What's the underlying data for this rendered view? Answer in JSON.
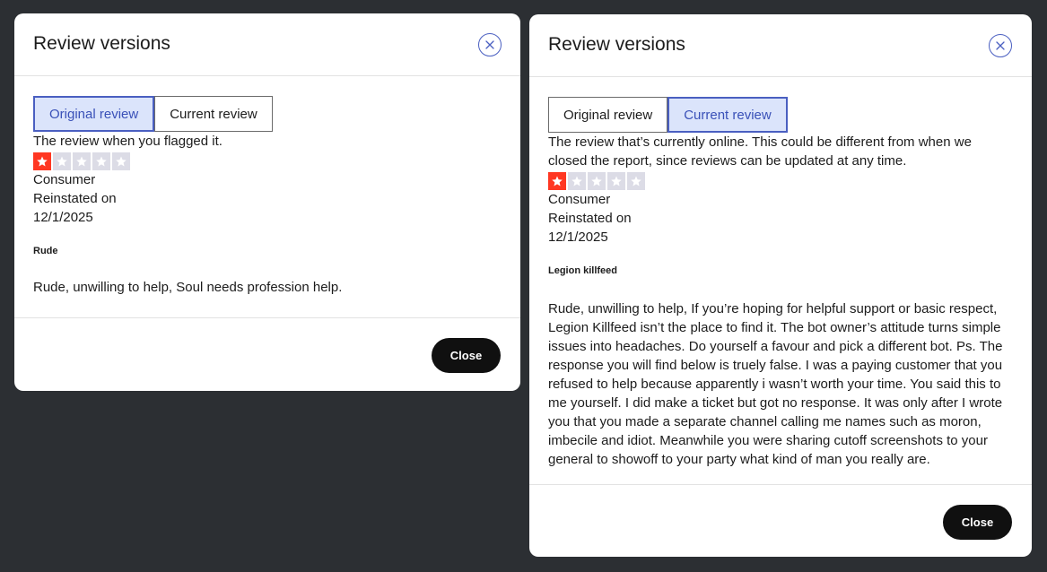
{
  "left_modal": {
    "title": "Review versions",
    "tabs": [
      {
        "label": "Original review",
        "active": true
      },
      {
        "label": "Current review",
        "active": false
      }
    ],
    "description": "The review when you flagged it.",
    "rating": 1,
    "rating_max": 5,
    "author": "Consumer",
    "status_label": "Reinstated on",
    "status_date": "12/1/2025",
    "review_title": "Rude",
    "review_text": "Rude, unwilling to help, Soul needs profession help.",
    "close_label": "Close"
  },
  "right_modal": {
    "title": "Review versions",
    "tabs": [
      {
        "label": "Original review",
        "active": false
      },
      {
        "label": "Current review",
        "active": true
      }
    ],
    "description": "The review that’s currently online. This could be different from when we closed the report, since reviews can be updated at any time.",
    "rating": 1,
    "rating_max": 5,
    "author": "Consumer",
    "status_label": "Reinstated on",
    "status_date": "12/1/2025",
    "review_title": "Legion killfeed",
    "review_text": "Rude, unwilling to help, If you’re hoping for helpful support or basic respect, Legion Killfeed isn’t the place to find it. The bot owner’s attitude turns simple issues into headaches. Do yourself a favour and pick a different bot. Ps. The response you will find below is truely false. I was a paying customer that you refused to help because apparently i wasn’t worth your time. You said this to me yourself. I did make a ticket but got no response. It was only after I wrote you that you made a separate channel calling me names such as moron, imbecile and idiot. Meanwhile you were sharing cutoff screenshots to your general to showoff to your party what kind of man you really are.",
    "close_label": "Close"
  },
  "icons": {
    "close": "close-icon",
    "star": "star-icon"
  },
  "colors": {
    "backdrop": "#2c2f33",
    "accent": "#4a5fc1",
    "active_tab_bg": "#dbe4fb",
    "star_filled": "#ff3722",
    "star_empty": "#dcdce6",
    "button_dark": "#101010"
  }
}
